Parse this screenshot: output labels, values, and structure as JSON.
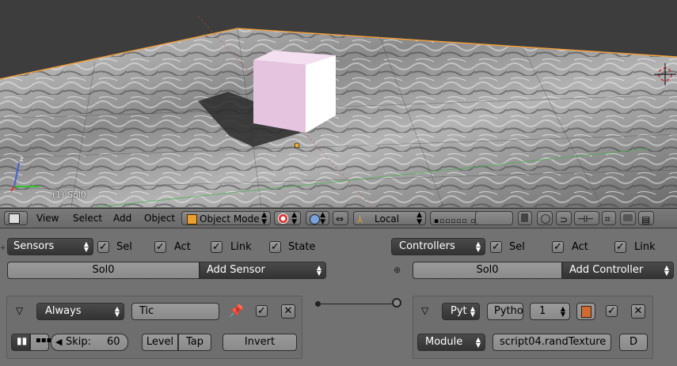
{
  "viewport": {
    "object_label": "(1) Sol0",
    "axis_z": "z"
  },
  "header": {
    "menus": [
      "View",
      "Select",
      "Add",
      "Object"
    ],
    "mode": "Object Mode",
    "orientation": "Local"
  },
  "sensors": {
    "title": "Sensors",
    "sel": "Sel",
    "act": "Act",
    "link": "Link",
    "state": "State",
    "object": "Sol0",
    "add": "Add Sensor",
    "item": {
      "type": "Always",
      "name": "Tic",
      "skip_label": "Skip:",
      "skip_value": "60",
      "level": "Level",
      "tap": "Tap",
      "invert": "Invert"
    }
  },
  "controllers": {
    "title": "Controllers",
    "sel": "Sel",
    "act": "Act",
    "link": "Link",
    "object": "Sol0",
    "add": "Add Controller",
    "item": {
      "type": "Pyt",
      "name": "Pytho",
      "priority": "1",
      "exec_mode": "Module",
      "module": "script04.randTexture",
      "debug": "D"
    }
  }
}
